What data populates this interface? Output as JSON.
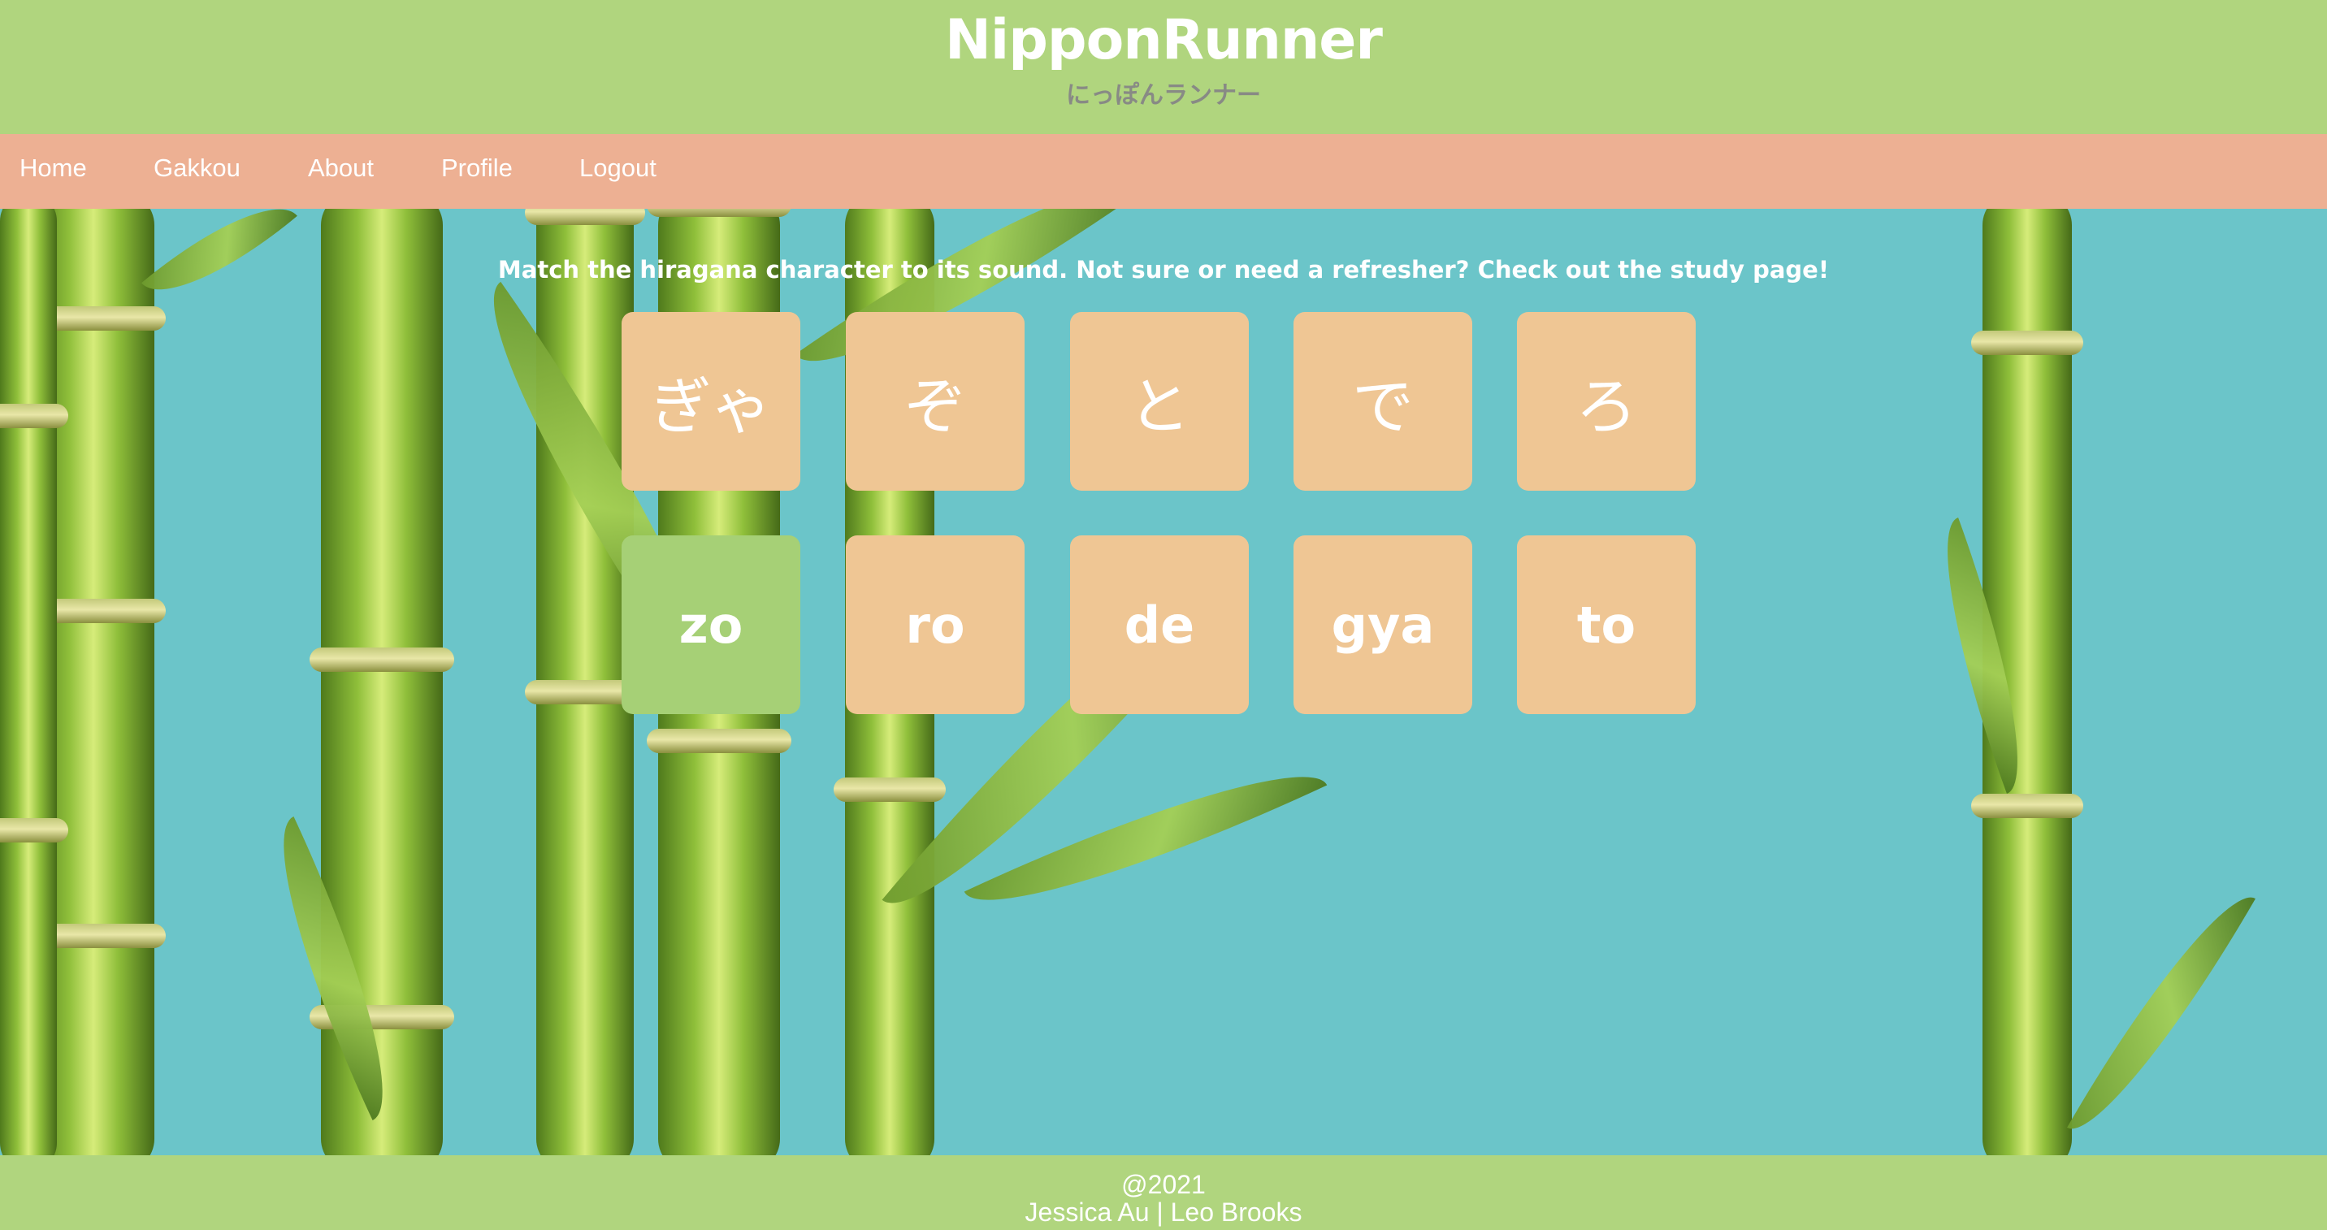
{
  "header": {
    "title": "NipponRunner",
    "subtitle": "にっぽんランナー"
  },
  "nav": {
    "items": [
      {
        "label": "Home"
      },
      {
        "label": "Gakkou"
      },
      {
        "label": "About"
      },
      {
        "label": "Profile"
      },
      {
        "label": "Logout"
      }
    ]
  },
  "main": {
    "instruction": "Match the hiragana character to its sound. Not sure or need a refresher? Check out the study page!",
    "kana_tiles": [
      {
        "label": "ぎゃ"
      },
      {
        "label": "ぞ"
      },
      {
        "label": "と"
      },
      {
        "label": "で"
      },
      {
        "label": "ろ"
      }
    ],
    "romaji_tiles": [
      {
        "label": "zo",
        "selected": true
      },
      {
        "label": "ro",
        "selected": false
      },
      {
        "label": "de",
        "selected": false
      },
      {
        "label": "gya",
        "selected": false
      },
      {
        "label": "to",
        "selected": false
      }
    ]
  },
  "footer": {
    "year": "@2021",
    "authors": "Jessica Au | Leo Brooks"
  },
  "colors": {
    "header_bg": "#b0d57e",
    "nav_bg": "#edb093",
    "main_bg": "#6bc5c9",
    "tile_bg": "#efc694",
    "tile_selected_bg": "#a6d076",
    "footer_bg": "#b0d57e"
  }
}
